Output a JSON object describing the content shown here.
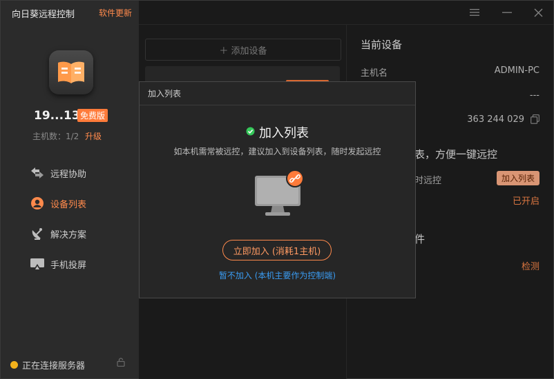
{
  "app": {
    "title": "向日葵远程控制",
    "update_label": "软件更新"
  },
  "account": {
    "device_code": "19...13",
    "plan_badge": "免费版",
    "host_count": "主机数：1/2",
    "upgrade_label": "升级"
  },
  "nav": {
    "items": [
      {
        "label": "远程协助",
        "icon": "remote-assist-icon"
      },
      {
        "label": "设备列表",
        "icon": "device-list-icon",
        "active": true
      },
      {
        "label": "解决方案",
        "icon": "satellite-dish-icon"
      },
      {
        "label": "手机投屏",
        "icon": "screen-cast-icon"
      }
    ]
  },
  "status": {
    "text": "正在连接服务器",
    "dot_color": "#f3b21b"
  },
  "device_list": {
    "add_device_label": "＋ 添加设备"
  },
  "current_device": {
    "title": "当前设备",
    "hostname_label": "主机名",
    "hostname_value": "ADMIN-PC",
    "row2_value": "---",
    "device_id": "363 244 029",
    "section_add_list": "表，方便一键远控",
    "remote_label": "时远控",
    "join_list_button": "加入列表",
    "enabled_text": "已开启",
    "section_plugin": "件",
    "detect_label": "检测"
  },
  "dialog": {
    "header": "加入列表",
    "title": "加入列表",
    "description": "如本机需常被远控，建议加入到设备列表，随时发起远控",
    "join_now_button": "立即加入 (消耗1主机)",
    "not_now_link": "暂不加入 (本机主要作为控制端)"
  },
  "colors": {
    "accent": "#ff8a4c",
    "link": "#3a9cf3",
    "success": "#35c759"
  }
}
